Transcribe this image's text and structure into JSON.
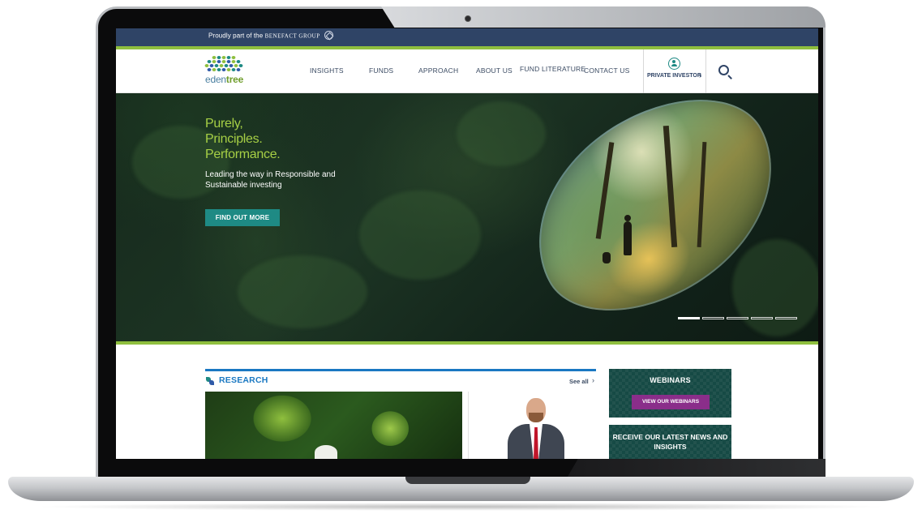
{
  "topbar": {
    "prefix": "Proudly part of the",
    "brand": "BENEFACT GROUP"
  },
  "logo": {
    "part1": "eden",
    "part2": "tree"
  },
  "nav": {
    "items": [
      {
        "label": "INSIGHTS"
      },
      {
        "label": "FUNDS"
      },
      {
        "label": "APPROACH"
      },
      {
        "label": "ABOUT US"
      },
      {
        "label": "FUND LITERATURE"
      },
      {
        "label": "CONTACT US"
      }
    ],
    "investor_label": "PRIVATE INVESTOR",
    "investor_chevron": "›"
  },
  "hero": {
    "title_lines": [
      "Purely,",
      "Principles.",
      "Performance."
    ],
    "subtitle": "Leading the way in Responsible and Sustainable investing",
    "cta_label": "FIND OUT MORE",
    "slides_total": 5,
    "active_slide": 1
  },
  "research": {
    "title": "RESEARCH",
    "see_all": "See all",
    "see_all_chevron": "›"
  },
  "webinars": {
    "title": "WEBINARS",
    "button": "VIEW OUR WEBINARS"
  },
  "news": {
    "title": "RECEIVE OUR LATEST NEWS AND INSIGHTS"
  },
  "colors": {
    "navy": "#2f4466",
    "green": "#8fbf3e",
    "teal": "#1e8a84",
    "hero_title": "#a6cf45",
    "research_blue": "#1a78c2",
    "panel": "#164a45",
    "purple": "#8a2e8a"
  }
}
